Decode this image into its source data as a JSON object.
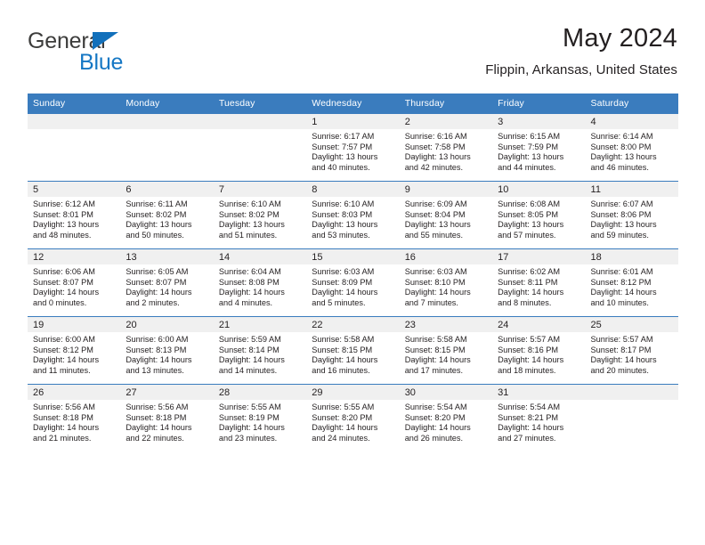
{
  "brand": {
    "name_part1": "General",
    "name_part2": "Blue",
    "triangle_color": "#1270bb",
    "blue_color": "#1577c4",
    "dark_color": "#3c3c3b"
  },
  "header": {
    "title": "May 2024",
    "location": "Flippin, Arkansas, United States"
  },
  "theme": {
    "header_bg": "#3a7cbe",
    "date_band_bg": "#f0f0f0",
    "text_color": "#231f20"
  },
  "weekday_headers": [
    "Sunday",
    "Monday",
    "Tuesday",
    "Wednesday",
    "Thursday",
    "Friday",
    "Saturday"
  ],
  "weeks": [
    [
      {
        "day": "",
        "sunrise": "",
        "sunset": "",
        "daylight_1": "",
        "daylight_2": ""
      },
      {
        "day": "",
        "sunrise": "",
        "sunset": "",
        "daylight_1": "",
        "daylight_2": ""
      },
      {
        "day": "",
        "sunrise": "",
        "sunset": "",
        "daylight_1": "",
        "daylight_2": ""
      },
      {
        "day": "1",
        "sunrise": "Sunrise: 6:17 AM",
        "sunset": "Sunset: 7:57 PM",
        "daylight_1": "Daylight: 13 hours",
        "daylight_2": "and 40 minutes."
      },
      {
        "day": "2",
        "sunrise": "Sunrise: 6:16 AM",
        "sunset": "Sunset: 7:58 PM",
        "daylight_1": "Daylight: 13 hours",
        "daylight_2": "and 42 minutes."
      },
      {
        "day": "3",
        "sunrise": "Sunrise: 6:15 AM",
        "sunset": "Sunset: 7:59 PM",
        "daylight_1": "Daylight: 13 hours",
        "daylight_2": "and 44 minutes."
      },
      {
        "day": "4",
        "sunrise": "Sunrise: 6:14 AM",
        "sunset": "Sunset: 8:00 PM",
        "daylight_1": "Daylight: 13 hours",
        "daylight_2": "and 46 minutes."
      }
    ],
    [
      {
        "day": "5",
        "sunrise": "Sunrise: 6:12 AM",
        "sunset": "Sunset: 8:01 PM",
        "daylight_1": "Daylight: 13 hours",
        "daylight_2": "and 48 minutes."
      },
      {
        "day": "6",
        "sunrise": "Sunrise: 6:11 AM",
        "sunset": "Sunset: 8:02 PM",
        "daylight_1": "Daylight: 13 hours",
        "daylight_2": "and 50 minutes."
      },
      {
        "day": "7",
        "sunrise": "Sunrise: 6:10 AM",
        "sunset": "Sunset: 8:02 PM",
        "daylight_1": "Daylight: 13 hours",
        "daylight_2": "and 51 minutes."
      },
      {
        "day": "8",
        "sunrise": "Sunrise: 6:10 AM",
        "sunset": "Sunset: 8:03 PM",
        "daylight_1": "Daylight: 13 hours",
        "daylight_2": "and 53 minutes."
      },
      {
        "day": "9",
        "sunrise": "Sunrise: 6:09 AM",
        "sunset": "Sunset: 8:04 PM",
        "daylight_1": "Daylight: 13 hours",
        "daylight_2": "and 55 minutes."
      },
      {
        "day": "10",
        "sunrise": "Sunrise: 6:08 AM",
        "sunset": "Sunset: 8:05 PM",
        "daylight_1": "Daylight: 13 hours",
        "daylight_2": "and 57 minutes."
      },
      {
        "day": "11",
        "sunrise": "Sunrise: 6:07 AM",
        "sunset": "Sunset: 8:06 PM",
        "daylight_1": "Daylight: 13 hours",
        "daylight_2": "and 59 minutes."
      }
    ],
    [
      {
        "day": "12",
        "sunrise": "Sunrise: 6:06 AM",
        "sunset": "Sunset: 8:07 PM",
        "daylight_1": "Daylight: 14 hours",
        "daylight_2": "and 0 minutes."
      },
      {
        "day": "13",
        "sunrise": "Sunrise: 6:05 AM",
        "sunset": "Sunset: 8:07 PM",
        "daylight_1": "Daylight: 14 hours",
        "daylight_2": "and 2 minutes."
      },
      {
        "day": "14",
        "sunrise": "Sunrise: 6:04 AM",
        "sunset": "Sunset: 8:08 PM",
        "daylight_1": "Daylight: 14 hours",
        "daylight_2": "and 4 minutes."
      },
      {
        "day": "15",
        "sunrise": "Sunrise: 6:03 AM",
        "sunset": "Sunset: 8:09 PM",
        "daylight_1": "Daylight: 14 hours",
        "daylight_2": "and 5 minutes."
      },
      {
        "day": "16",
        "sunrise": "Sunrise: 6:03 AM",
        "sunset": "Sunset: 8:10 PM",
        "daylight_1": "Daylight: 14 hours",
        "daylight_2": "and 7 minutes."
      },
      {
        "day": "17",
        "sunrise": "Sunrise: 6:02 AM",
        "sunset": "Sunset: 8:11 PM",
        "daylight_1": "Daylight: 14 hours",
        "daylight_2": "and 8 minutes."
      },
      {
        "day": "18",
        "sunrise": "Sunrise: 6:01 AM",
        "sunset": "Sunset: 8:12 PM",
        "daylight_1": "Daylight: 14 hours",
        "daylight_2": "and 10 minutes."
      }
    ],
    [
      {
        "day": "19",
        "sunrise": "Sunrise: 6:00 AM",
        "sunset": "Sunset: 8:12 PM",
        "daylight_1": "Daylight: 14 hours",
        "daylight_2": "and 11 minutes."
      },
      {
        "day": "20",
        "sunrise": "Sunrise: 6:00 AM",
        "sunset": "Sunset: 8:13 PM",
        "daylight_1": "Daylight: 14 hours",
        "daylight_2": "and 13 minutes."
      },
      {
        "day": "21",
        "sunrise": "Sunrise: 5:59 AM",
        "sunset": "Sunset: 8:14 PM",
        "daylight_1": "Daylight: 14 hours",
        "daylight_2": "and 14 minutes."
      },
      {
        "day": "22",
        "sunrise": "Sunrise: 5:58 AM",
        "sunset": "Sunset: 8:15 PM",
        "daylight_1": "Daylight: 14 hours",
        "daylight_2": "and 16 minutes."
      },
      {
        "day": "23",
        "sunrise": "Sunrise: 5:58 AM",
        "sunset": "Sunset: 8:15 PM",
        "daylight_1": "Daylight: 14 hours",
        "daylight_2": "and 17 minutes."
      },
      {
        "day": "24",
        "sunrise": "Sunrise: 5:57 AM",
        "sunset": "Sunset: 8:16 PM",
        "daylight_1": "Daylight: 14 hours",
        "daylight_2": "and 18 minutes."
      },
      {
        "day": "25",
        "sunrise": "Sunrise: 5:57 AM",
        "sunset": "Sunset: 8:17 PM",
        "daylight_1": "Daylight: 14 hours",
        "daylight_2": "and 20 minutes."
      }
    ],
    [
      {
        "day": "26",
        "sunrise": "Sunrise: 5:56 AM",
        "sunset": "Sunset: 8:18 PM",
        "daylight_1": "Daylight: 14 hours",
        "daylight_2": "and 21 minutes."
      },
      {
        "day": "27",
        "sunrise": "Sunrise: 5:56 AM",
        "sunset": "Sunset: 8:18 PM",
        "daylight_1": "Daylight: 14 hours",
        "daylight_2": "and 22 minutes."
      },
      {
        "day": "28",
        "sunrise": "Sunrise: 5:55 AM",
        "sunset": "Sunset: 8:19 PM",
        "daylight_1": "Daylight: 14 hours",
        "daylight_2": "and 23 minutes."
      },
      {
        "day": "29",
        "sunrise": "Sunrise: 5:55 AM",
        "sunset": "Sunset: 8:20 PM",
        "daylight_1": "Daylight: 14 hours",
        "daylight_2": "and 24 minutes."
      },
      {
        "day": "30",
        "sunrise": "Sunrise: 5:54 AM",
        "sunset": "Sunset: 8:20 PM",
        "daylight_1": "Daylight: 14 hours",
        "daylight_2": "and 26 minutes."
      },
      {
        "day": "31",
        "sunrise": "Sunrise: 5:54 AM",
        "sunset": "Sunset: 8:21 PM",
        "daylight_1": "Daylight: 14 hours",
        "daylight_2": "and 27 minutes."
      },
      {
        "day": "",
        "sunrise": "",
        "sunset": "",
        "daylight_1": "",
        "daylight_2": ""
      }
    ]
  ]
}
